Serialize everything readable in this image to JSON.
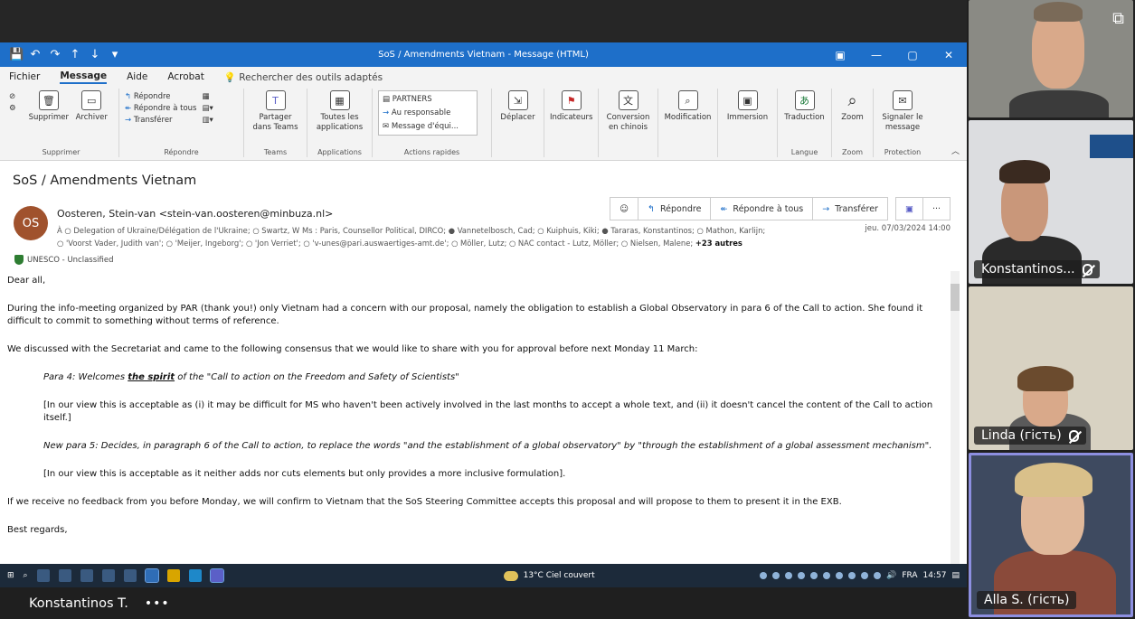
{
  "window": {
    "title": "SoS / Amendments Vietnam  -  Message (HTML)"
  },
  "menu": {
    "items": [
      "Fichier",
      "Message",
      "Aide",
      "Acrobat"
    ],
    "search": "Rechercher des outils adaptés"
  },
  "ribbon": {
    "supprimer": {
      "delete": "Supprimer",
      "archive": "Archiver",
      "label": "Supprimer"
    },
    "repondre": {
      "reply": "Répondre",
      "reply_all": "Répondre à tous",
      "forward": "Transférer",
      "label": "Répondre"
    },
    "teams": {
      "share": "Partager dans Teams",
      "label": "Teams"
    },
    "apps": {
      "all": "Toutes les applications",
      "label": "Applications"
    },
    "quick": {
      "items": [
        "PARTNERS",
        "Au responsable",
        "Message d'équi..."
      ],
      "label": "Actions rapides"
    },
    "deplacer": "Déplacer",
    "indicateurs": "Indicateurs",
    "conversion": "Conversion en chinois",
    "modification": "Modification",
    "immersion": "Immersion",
    "langue": {
      "traduction": "Traduction",
      "label": "Langue"
    },
    "zoom": {
      "zoom": "Zoom",
      "label": "Zoom"
    },
    "protection": {
      "report": "Signaler le message",
      "label": "Protection"
    }
  },
  "message": {
    "subject": "SoS / Amendments Vietnam",
    "avatar_initials": "OS",
    "sender": "Oosteren, Stein-van <stein-van.oosteren@minbuza.nl>",
    "recipients_line1": "À  ○ Delegation of Ukraine/Délégation de l'Ukraine; ○ Swartz, W Ms : Paris, Counsellor Political, DIRCO; ● Vannetelbosch, Cad; ○ Kuiphuis, Kiki; ● Tararas, Konstantinos; ○ Mathon, Karlijn;",
    "recipients_line2": "○ 'Voorst Vader, Judith van'; ○ 'Meijer, Ingeborg'; ○ 'Jon Verriet'; ○ 'v-unes@pari.auswaertiges-amt.de'; ○ Möller, Lutz; ○ NAC contact - Lutz, Möller; ○ Nielsen, Malene;",
    "recipients_more": "+23 autres",
    "date": "jeu. 07/03/2024 14:00",
    "actions": {
      "reply": "Répondre",
      "reply_all": "Répondre à tous",
      "forward": "Transférer"
    },
    "sensitivity": "UNESCO - Unclassified",
    "body": {
      "greeting": "Dear all,",
      "p1": "During the info-meeting organized by PAR (thank you!) only Vietnam had a concern with our proposal, namely the obligation to establish a Global Observatory in para 6 of the Call to action. She found it difficult to commit to something without terms of reference.",
      "p2": "We discussed with the Secretariat and came to the following consensus that we would like to share with you for approval before next Monday 11 March:",
      "para4_prefix": "Para 4: Welcomes ",
      "para4_strong": "the spirit",
      "para4_suffix": " of the \"Call to action on the Freedom and Safety of Scientists\"",
      "comment1": "[In our view this is acceptable as (i) it may be difficult for MS who haven't been actively involved in the last months to accept a whole text, and (ii) it doesn't cancel the content of the Call to action itself.]",
      "para5": "New para 5: Decides, in paragraph 6 of the Call to action, to replace the words \"and the establishment of a global observatory\" by \"through the establishment of a global assessment mechanism\".",
      "comment2": "[In our view this is acceptable as it neither adds nor cuts elements but only provides a more inclusive formulation].",
      "p3": "If we receive no feedback from you before Monday, we will confirm to Vietnam that the SoS Steering Committee accepts this proposal and will propose to them to present it in the EXB.",
      "closing": "Best regards,"
    }
  },
  "taskbar": {
    "weather": "13°C  Ciel couvert",
    "lang": "FRA",
    "time": "14:57"
  },
  "call": {
    "presenter": "Konstantinos T.",
    "more": "•••",
    "participants": [
      {
        "name": ""
      },
      {
        "name": "Konstantinos..."
      },
      {
        "name": "Linda (гість)"
      },
      {
        "name": "Alla S. (гість)"
      }
    ]
  },
  "colors": {
    "outlook_blue": "#1e6fc9",
    "active_speaker": "#8d8fe0",
    "avatar": "#a0522d"
  }
}
